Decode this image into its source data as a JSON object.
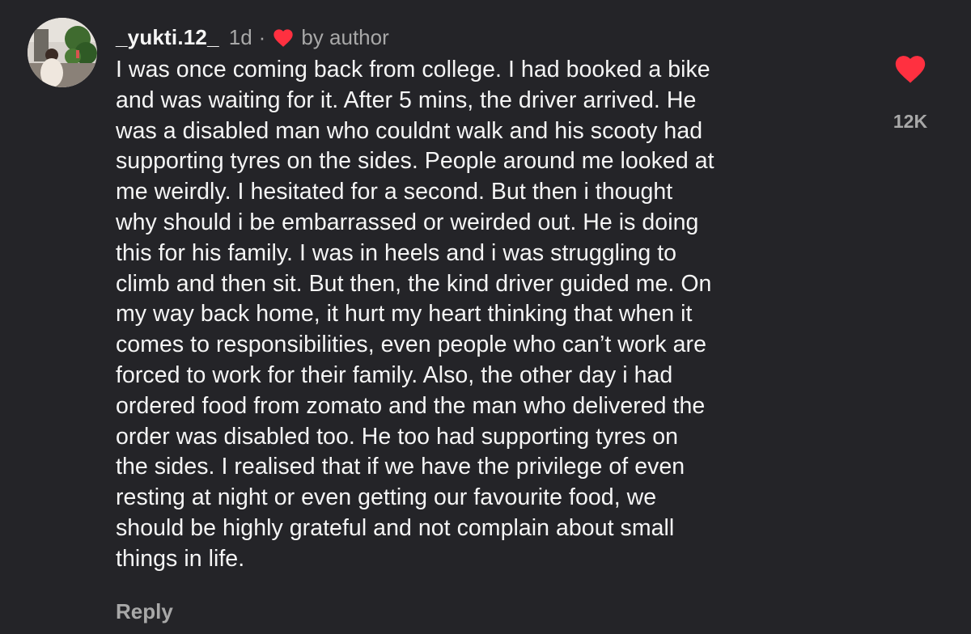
{
  "comment": {
    "username": "_yukti.12_",
    "time_ago": "1d",
    "separator": "·",
    "author_badge": "by author",
    "body_lines": [
      "I was once coming back from college. I had booked a bike",
      "and was waiting for it. After 5 mins, the driver arrived. He",
      "was a disabled man who couldnt walk and his scooty had",
      "supporting tyres on the sides. People around me looked at",
      "me weirdly. I hesitated for a second. But then i thought",
      "why should i be embarrassed or weirded out. He is doing",
      "this for his family. I was in heels and i was struggling to",
      "climb and then sit. But then, the kind driver guided me. On",
      "my way back home, it hurt my heart thinking that when it",
      "comes to responsibilities, even people who can’t work are",
      "forced to work for their family. Also, the other day i had",
      "ordered food from zomato and the man who delivered the",
      "order was disabled too. He too had supporting tyres on",
      "the sides. I realised that if we have the privilege of even",
      "resting at night or even getting our favourite food, we",
      "should be highly grateful and not complain about small",
      "things in life."
    ],
    "reply_label": "Reply",
    "like_count": "12K",
    "liked": true
  },
  "colors": {
    "background": "#242428",
    "text_primary": "#f5f5f5",
    "text_secondary": "#a8a8a8",
    "heart_red": "#ff3040"
  },
  "icons": {
    "avatar": "profile-photo",
    "author_like": "heart-icon",
    "like": "heart-icon"
  }
}
